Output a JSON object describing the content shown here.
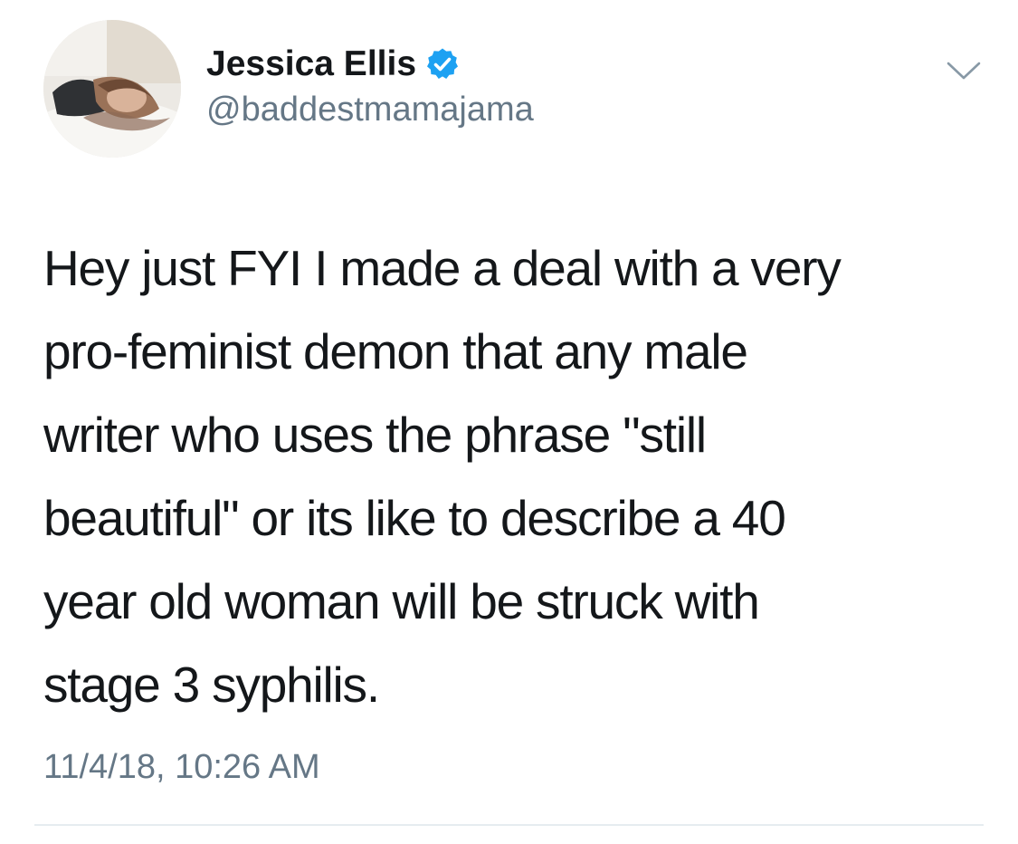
{
  "tweet": {
    "author": {
      "display_name": "Jessica Ellis",
      "handle": "@baddestmamajama",
      "verified": true,
      "avatar_icon": "profile-photo"
    },
    "body_lines": [
      "Hey just FYI I made a deal with a very",
      "pro-feminist demon that any male",
      "writer who uses the phrase \"still",
      "beautiful\" or its like to describe a 40",
      "year old woman will be struck with",
      "stage 3 syphilis."
    ],
    "timestamp": "11/4/18, 10:26 AM",
    "menu_icon": "chevron-down-icon"
  },
  "colors": {
    "text_primary": "#14171a",
    "text_secondary": "#657786",
    "verified_blue": "#1da1f2",
    "divider": "#e6ecf0"
  }
}
